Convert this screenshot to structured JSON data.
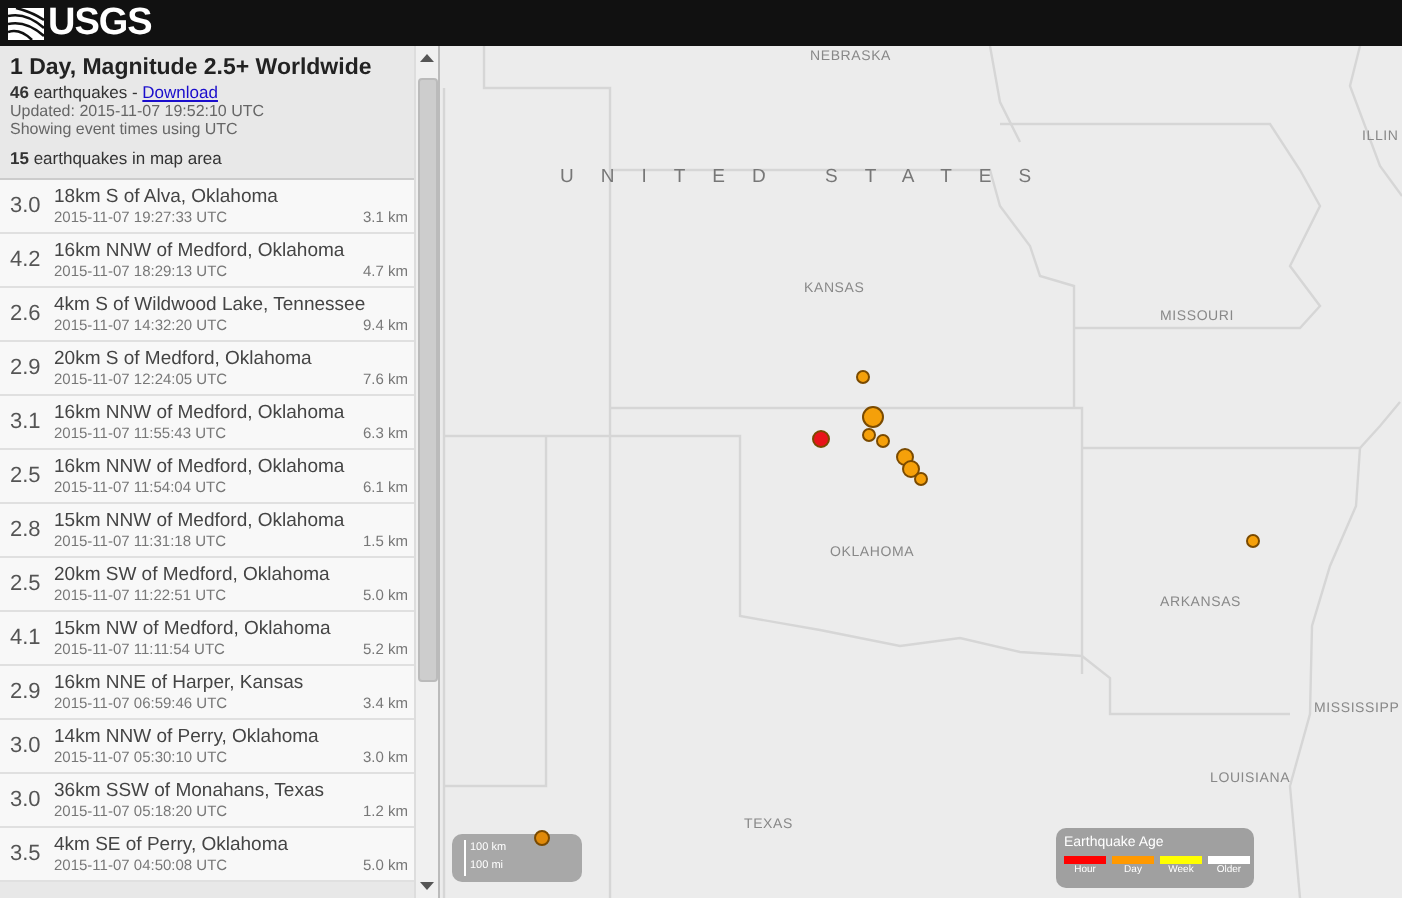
{
  "header": {
    "logo_text": "USGS"
  },
  "summary": {
    "title": "1 Day, Magnitude 2.5+ Worldwide",
    "count_text": "**46** earthquakes - ",
    "download_link": "Download",
    "updated": "Updated: 2015-11-07 19:52:10 UTC",
    "timezone_note": "Showing event times using UTC",
    "map_count_text": "**15** earthquakes in map area"
  },
  "events": [
    {
      "magnitude": "3.0",
      "place": "18km S of Alva, Oklahoma",
      "time": "2015-11-07 19:27:33 UTC",
      "depth": "3.1 km"
    },
    {
      "magnitude": "4.2",
      "place": "16km NNW of Medford, Oklahoma",
      "time": "2015-11-07 18:29:13 UTC",
      "depth": "4.7 km"
    },
    {
      "magnitude": "2.6",
      "place": "4km S of Wildwood Lake, Tennessee",
      "time": "2015-11-07 14:32:20 UTC",
      "depth": "9.4 km"
    },
    {
      "magnitude": "2.9",
      "place": "20km S of Medford, Oklahoma",
      "time": "2015-11-07 12:24:05 UTC",
      "depth": "7.6 km"
    },
    {
      "magnitude": "3.1",
      "place": "16km NNW of Medford, Oklahoma",
      "time": "2015-11-07 11:55:43 UTC",
      "depth": "6.3 km"
    },
    {
      "magnitude": "2.5",
      "place": "16km NNW of Medford, Oklahoma",
      "time": "2015-11-07 11:54:04 UTC",
      "depth": "6.1 km"
    },
    {
      "magnitude": "2.8",
      "place": "15km NNW of Medford, Oklahoma",
      "time": "2015-11-07 11:31:18 UTC",
      "depth": "1.5 km"
    },
    {
      "magnitude": "2.5",
      "place": "20km SW of Medford, Oklahoma",
      "time": "2015-11-07 11:22:51 UTC",
      "depth": "5.0 km"
    },
    {
      "magnitude": "4.1",
      "place": "15km NW of Medford, Oklahoma",
      "time": "2015-11-07 11:11:54 UTC",
      "depth": "5.2 km"
    },
    {
      "magnitude": "2.9",
      "place": "16km NNE of Harper, Kansas",
      "time": "2015-11-07 06:59:46 UTC",
      "depth": "3.4 km"
    },
    {
      "magnitude": "3.0",
      "place": "14km NNW of Perry, Oklahoma",
      "time": "2015-11-07 05:30:10 UTC",
      "depth": "3.0 km"
    },
    {
      "magnitude": "3.0",
      "place": "36km SSW of Monahans, Texas",
      "time": "2015-11-07 05:18:20 UTC",
      "depth": "1.2 km"
    },
    {
      "magnitude": "3.5",
      "place": "4km SE of Perry, Oklahoma",
      "time": "2015-11-07 04:50:08 UTC",
      "depth": "5.0 km"
    }
  ],
  "map": {
    "labels": [
      {
        "text": "NEBRASKA",
        "kind": "state"
      },
      {
        "text": "UNITED STATES",
        "kind": "country"
      },
      {
        "text": "ILLIN",
        "kind": "state"
      },
      {
        "text": "KANSAS",
        "kind": "state"
      },
      {
        "text": "MISSOURI",
        "kind": "state"
      },
      {
        "text": "OKLAHOMA",
        "kind": "state"
      },
      {
        "text": "ARKANSAS",
        "kind": "state"
      },
      {
        "text": "MISSISSIPP",
        "kind": "state"
      },
      {
        "text": "LOUISIANA",
        "kind": "state"
      },
      {
        "text": "TEXAS",
        "kind": "state"
      }
    ],
    "markers": [
      {
        "color": "#f5a00a"
      },
      {
        "color": "#f5a00a"
      },
      {
        "color": "#f5a00a"
      },
      {
        "color": "#f5a00a"
      },
      {
        "color": "#f5a00a"
      },
      {
        "color": "#f5a00a"
      },
      {
        "color": "#f5a00a"
      },
      {
        "color": "#e8141a"
      },
      {
        "color": "#f5a00a"
      },
      {
        "color": "#e08a0a"
      }
    ],
    "scale": [
      "100 km",
      "100 mi"
    ],
    "legend": {
      "title": "Earthquake Age",
      "items": [
        {
          "label": "Hour",
          "color": "#ff0000"
        },
        {
          "label": "Day",
          "color": "#ff9900"
        },
        {
          "label": "Week",
          "color": "#ffff00"
        },
        {
          "label": "Older",
          "color": "#ffffff"
        }
      ]
    }
  }
}
